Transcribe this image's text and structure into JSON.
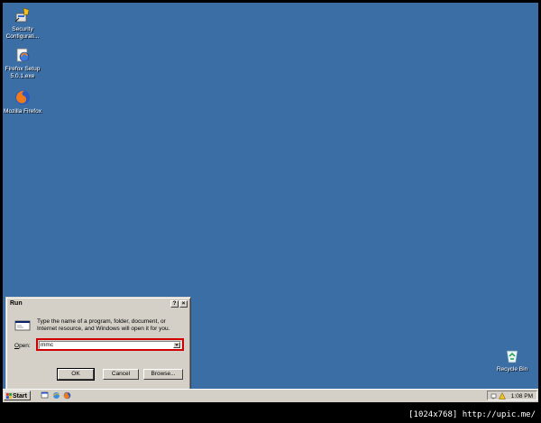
{
  "desktop": {
    "icons": [
      {
        "label_line1": "Security",
        "label_line2": "Configurati..."
      },
      {
        "label_line1": "Firefox Setup",
        "label_line2": "5.0.1.exe"
      },
      {
        "label_line1": "Mozilla Firefox",
        "label_line2": ""
      },
      {
        "label_line1": "Recycle Bin",
        "label_line2": ""
      }
    ]
  },
  "run_dialog": {
    "title": "Run",
    "help_btn": "?",
    "close_btn": "×",
    "description": "Type the name of a program, folder, document, or Internet resource, and Windows will open it for you.",
    "open_label_prefix": "O",
    "open_label_rest": "pen:",
    "open_value": "mmc",
    "ok_label": "OK",
    "cancel_label": "Cancel",
    "browse_label": "Browse..."
  },
  "taskbar": {
    "start_label": "Start",
    "clock": "1:08 PM"
  },
  "watermark": "[1024x768] http://upic.me/",
  "colors": {
    "desktop": "#3a6ea5",
    "highlight": "#d00000",
    "chrome": "#d4d0c8"
  }
}
